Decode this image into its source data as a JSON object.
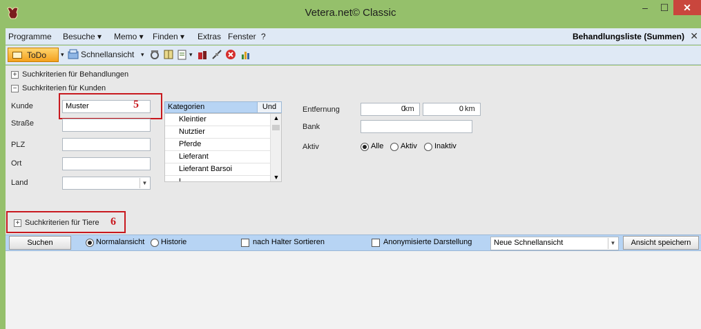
{
  "window": {
    "title": "Vetera.net© Classic",
    "minimize": "–",
    "maximize": "☐",
    "close": "✕"
  },
  "menu": {
    "items": [
      "Programme",
      "Besuche ▾",
      "Memo ▾",
      "Finden ▾",
      "Extras",
      "Fenster",
      "?"
    ],
    "active_view": "Behandlungsliste (Summen)",
    "close_tab": "✕"
  },
  "toolbar": {
    "todo_label": "ToDo",
    "todo_dropdown": "▾",
    "quickview_label": "Schnellansicht",
    "quickview_dropdown": "▾"
  },
  "criteria": {
    "treatments_toggle": "+",
    "treatments_label": "Suchkriterien für Behandlungen",
    "customers_toggle": "−",
    "customers_label": "Suchkriterien für Kunden",
    "animals_toggle": "+",
    "animals_label": "Suchkriterien für Tiere"
  },
  "customer_form": {
    "kunde_label": "Kunde",
    "kunde_value": "Muster",
    "strasse_label": "Straße",
    "strasse_value": "",
    "plz_label": "PLZ",
    "plz_value": "",
    "ort_label": "Ort",
    "ort_value": "",
    "land_label": "Land",
    "land_value": ""
  },
  "categories": {
    "header": "Kategorien",
    "mode": "Und",
    "items": [
      "Kleintier",
      "Nutztier",
      "Pferde",
      "Lieferant",
      "Lieferant Barsoi",
      "Ӏ"
    ]
  },
  "distance": {
    "label": "Entfernung",
    "from_value": "0",
    "to_value": "0",
    "unit": "km"
  },
  "bank": {
    "label": "Bank",
    "value": ""
  },
  "active": {
    "label": "Aktiv",
    "options": [
      "Alle",
      "Aktiv",
      "Inaktiv"
    ],
    "selected": "Alle"
  },
  "annotations": {
    "kunde_marker": "5",
    "tiere_marker": "6"
  },
  "search_bar": {
    "search_button": "Suchen",
    "view_options": [
      "Normalansicht",
      "Historie"
    ],
    "view_selected": "Normalansicht",
    "sort_by_owner": "nach Halter Sortieren",
    "anonymized": "Anonymisierte Darstellung",
    "quickview_select": "Neue Schnellansicht",
    "save_view": "Ansicht speichern"
  },
  "colors": {
    "title_bar": "#95c06b",
    "menu_bg": "#dfe9f5",
    "accent_blue": "#b7d4f4",
    "annotation_red": "#c8181e"
  }
}
